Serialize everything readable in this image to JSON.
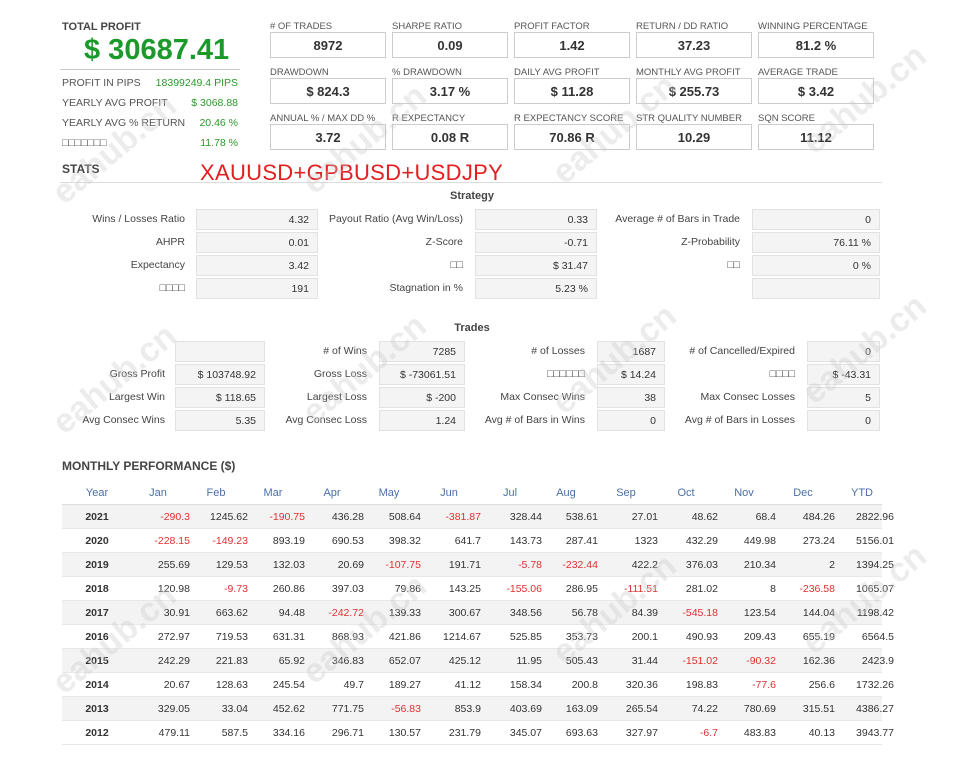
{
  "summary": {
    "total_profit_label": "TOTAL PROFIT",
    "total_profit": "$ 30687.41",
    "rows": [
      {
        "label": "PROFIT IN PIPS",
        "value": "18399249.4 PIPS"
      },
      {
        "label": "YEARLY AVG PROFIT",
        "value": "$ 3068.88"
      },
      {
        "label": "YEARLY AVG % RETURN",
        "value": "20.46 %"
      },
      {
        "label": "□□□□□□□",
        "value": "11.78 %"
      }
    ]
  },
  "kpis": [
    {
      "label": "# OF TRADES",
      "value": "8972"
    },
    {
      "label": "SHARPE RATIO",
      "value": "0.09"
    },
    {
      "label": "PROFIT FACTOR",
      "value": "1.42"
    },
    {
      "label": "RETURN / DD RATIO",
      "value": "37.23"
    },
    {
      "label": "WINNING PERCENTAGE",
      "value": "81.2 %"
    },
    {
      "label": "DRAWDOWN",
      "value": "$ 824.3"
    },
    {
      "label": "% DRAWDOWN",
      "value": "3.17 %"
    },
    {
      "label": "DAILY AVG PROFIT",
      "value": "$ 11.28"
    },
    {
      "label": "MONTHLY AVG PROFIT",
      "value": "$ 255.73"
    },
    {
      "label": "AVERAGE TRADE",
      "value": "$ 3.42"
    },
    {
      "label": "ANNUAL % / MAX DD %",
      "value": "3.72"
    },
    {
      "label": "R EXPECTANCY",
      "value": "0.08 R"
    },
    {
      "label": "R EXPECTANCY SCORE",
      "value": "70.86 R"
    },
    {
      "label": "STR QUALITY NUMBER",
      "value": "10.29"
    },
    {
      "label": "SQN SCORE",
      "value": "11.12"
    }
  ],
  "stats_title": "STATS",
  "pair_title": "XAUUSD+GPBUSD+USDJPY",
  "strategy": {
    "title": "Strategy",
    "rows": [
      [
        {
          "label": "Wins / Losses Ratio",
          "value": "4.32"
        },
        {
          "label": "Payout Ratio (Avg Win/Loss)",
          "value": "0.33"
        },
        {
          "label": "Average # of Bars in Trade",
          "value": "0"
        }
      ],
      [
        {
          "label": "AHPR",
          "value": "0.01"
        },
        {
          "label": "Z-Score",
          "value": "-0.71"
        },
        {
          "label": "Z-Probability",
          "value": "76.11 %"
        }
      ],
      [
        {
          "label": "Expectancy",
          "value": "3.42"
        },
        {
          "label": "□□",
          "value": "$ 31.47"
        },
        {
          "label": "□□",
          "value": "0 %"
        }
      ],
      [
        {
          "label": "□□□□",
          "value": "191"
        },
        {
          "label": "Stagnation in %",
          "value": "5.23 %"
        },
        {
          "label": "",
          "value": ""
        }
      ]
    ]
  },
  "trades": {
    "title": "Trades",
    "rows": [
      [
        {
          "label": "",
          "value": ""
        },
        {
          "label": "# of Wins",
          "value": "7285"
        },
        {
          "label": "# of Losses",
          "value": "1687"
        },
        {
          "label": "# of Cancelled/Expired",
          "value": "0"
        }
      ],
      [
        {
          "label": "Gross Profit",
          "value": "$ 103748.92"
        },
        {
          "label": "Gross Loss",
          "value": "$ -73061.51"
        },
        {
          "label": "□□□□□□",
          "value": "$ 14.24"
        },
        {
          "label": "□□□□",
          "value": "$ -43.31"
        }
      ],
      [
        {
          "label": "Largest Win",
          "value": "$ 118.65"
        },
        {
          "label": "Largest Loss",
          "value": "$ -200"
        },
        {
          "label": "Max Consec Wins",
          "value": "38"
        },
        {
          "label": "Max Consec Losses",
          "value": "5"
        }
      ],
      [
        {
          "label": "Avg Consec Wins",
          "value": "5.35"
        },
        {
          "label": "Avg Consec Loss",
          "value": "1.24"
        },
        {
          "label": "Avg # of Bars in Wins",
          "value": "0"
        },
        {
          "label": "Avg # of Bars in Losses",
          "value": "0"
        }
      ]
    ]
  },
  "monthly": {
    "title": "MONTHLY PERFORMANCE ($)",
    "headers": [
      "Year",
      "Jan",
      "Feb",
      "Mar",
      "Apr",
      "May",
      "Jun",
      "Jul",
      "Aug",
      "Sep",
      "Oct",
      "Nov",
      "Dec",
      "YTD"
    ],
    "rows": [
      [
        "2021",
        "-290.3",
        "1245.62",
        "-190.75",
        "436.28",
        "508.64",
        "-381.87",
        "328.44",
        "538.61",
        "27.01",
        "48.62",
        "68.4",
        "484.26",
        "2822.96"
      ],
      [
        "2020",
        "-228.15",
        "-149.23",
        "893.19",
        "690.53",
        "398.32",
        "641.7",
        "143.73",
        "287.41",
        "1323",
        "432.29",
        "449.98",
        "273.24",
        "5156.01"
      ],
      [
        "2019",
        "255.69",
        "129.53",
        "132.03",
        "20.69",
        "-107.75",
        "191.71",
        "-5.78",
        "-232.44",
        "422.2",
        "376.03",
        "210.34",
        "2",
        "1394.25"
      ],
      [
        "2018",
        "120.98",
        "-9.73",
        "260.86",
        "397.03",
        "79.86",
        "143.25",
        "-155.06",
        "286.95",
        "-111.51",
        "281.02",
        "8",
        "-236.58",
        "1065.07"
      ],
      [
        "2017",
        "30.91",
        "663.62",
        "94.48",
        "-242.72",
        "139.33",
        "300.67",
        "348.56",
        "56.78",
        "84.39",
        "-545.18",
        "123.54",
        "144.04",
        "1198.42"
      ],
      [
        "2016",
        "272.97",
        "719.53",
        "631.31",
        "868.93",
        "421.86",
        "1214.67",
        "525.85",
        "353.73",
        "200.1",
        "490.93",
        "209.43",
        "655.19",
        "6564.5"
      ],
      [
        "2015",
        "242.29",
        "221.83",
        "65.92",
        "346.83",
        "652.07",
        "425.12",
        "11.95",
        "505.43",
        "31.44",
        "-151.02",
        "-90.32",
        "162.36",
        "2423.9"
      ],
      [
        "2014",
        "20.67",
        "128.63",
        "245.54",
        "49.7",
        "189.27",
        "41.12",
        "158.34",
        "200.8",
        "320.36",
        "198.83",
        "-77.6",
        "256.6",
        "1732.26"
      ],
      [
        "2013",
        "329.05",
        "33.04",
        "452.62",
        "771.75",
        "-56.83",
        "853.9",
        "403.69",
        "163.09",
        "265.54",
        "74.22",
        "780.69",
        "315.51",
        "4386.27"
      ],
      [
        "2012",
        "479.11",
        "587.5",
        "334.16",
        "296.71",
        "130.57",
        "231.79",
        "345.07",
        "693.63",
        "327.97",
        "-6.7",
        "483.83",
        "40.13",
        "3943.77"
      ]
    ]
  },
  "watermark": "eahub.cn",
  "colors": {
    "profit": "#1a9a2a",
    "negative": "#e03030",
    "header": "#4a6fa5",
    "pair": "#e02020"
  }
}
